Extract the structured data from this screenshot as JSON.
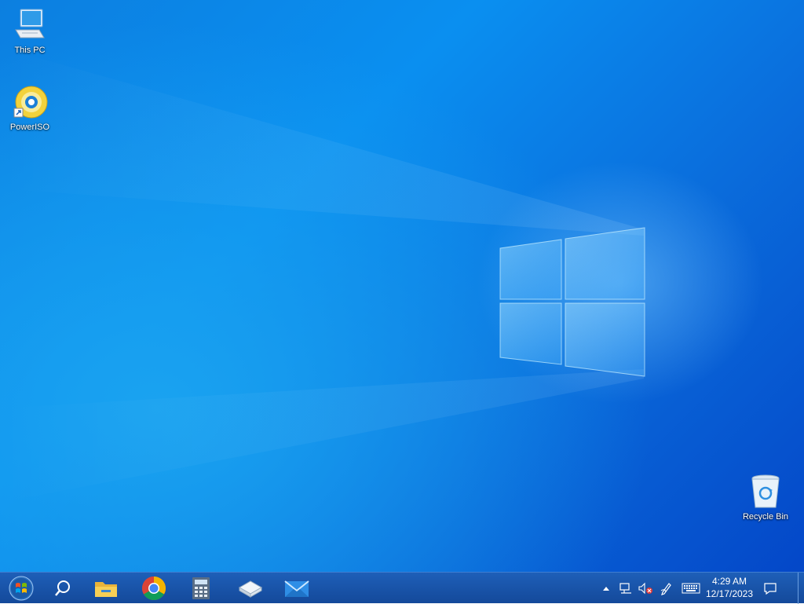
{
  "desktop": {
    "icons": [
      {
        "label": "This PC"
      },
      {
        "label": "PowerISO"
      },
      {
        "label": "Recycle Bin"
      }
    ]
  },
  "taskbar": {
    "pinned": [
      {
        "icon": "start-orb-icon"
      },
      {
        "icon": "search-icon"
      },
      {
        "icon": "file-explorer-icon"
      },
      {
        "icon": "chrome-icon"
      },
      {
        "icon": "calculator-icon"
      },
      {
        "icon": "drive-icon"
      },
      {
        "icon": "mail-icon"
      }
    ],
    "tray": {
      "icons": [
        "chevron-up-icon",
        "network-icon",
        "volume-muted-icon",
        "pen-icon",
        "keyboard-icon"
      ],
      "time": "4:29 AM",
      "date": "12/17/2023",
      "notification_icon": "notification-icon"
    }
  },
  "colors": {
    "taskbar": "#14499a",
    "desktop_accent": "#0a8ff0"
  }
}
